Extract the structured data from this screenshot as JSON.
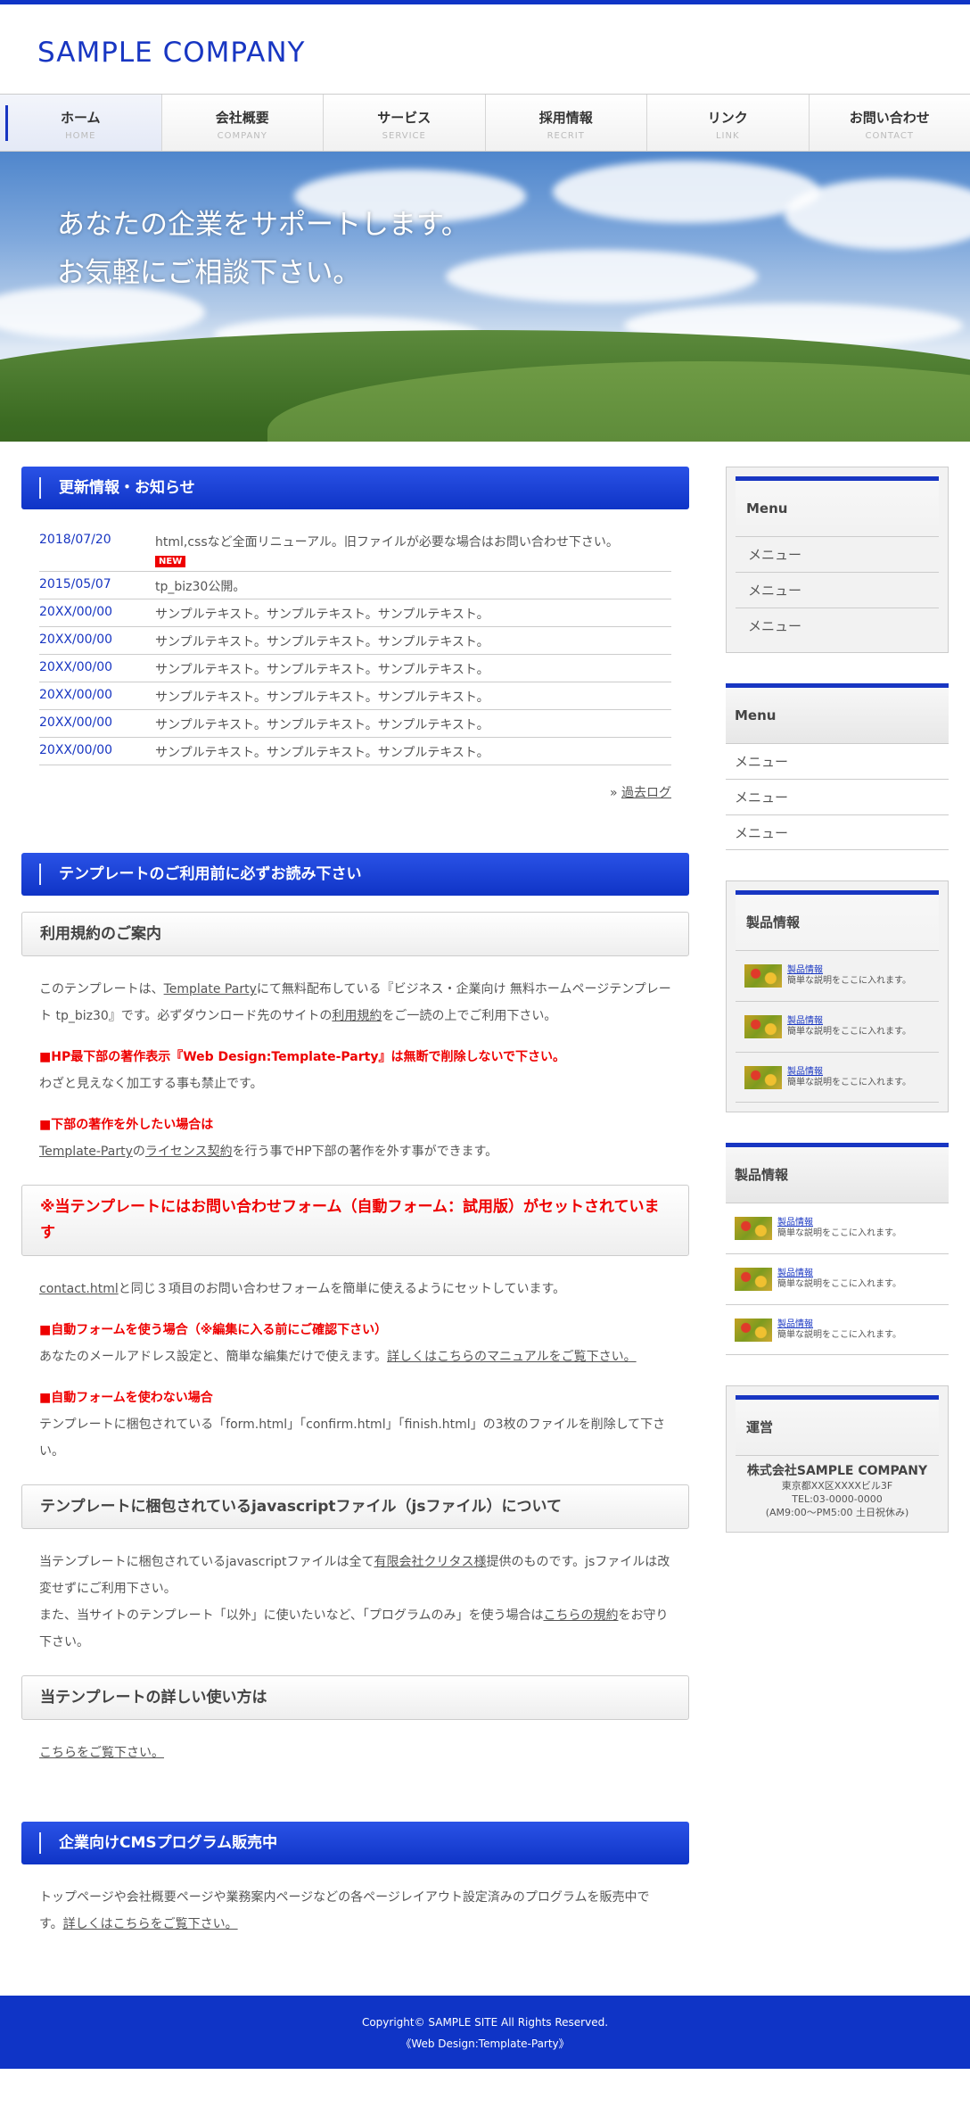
{
  "site": {
    "logo": "SAMPLE COMPANY"
  },
  "nav": [
    {
      "ja": "ホーム",
      "en": "HOME"
    },
    {
      "ja": "会社概要",
      "en": "COMPANY"
    },
    {
      "ja": "サービス",
      "en": "SERVICE"
    },
    {
      "ja": "採用情報",
      "en": "RECRIT"
    },
    {
      "ja": "リンク",
      "en": "LINK"
    },
    {
      "ja": "お問い合わせ",
      "en": "CONTACT"
    }
  ],
  "hero": {
    "line1": "あなたの企業をサポートします。",
    "line2": "お気軽にご相談下さい。"
  },
  "news": {
    "title": "更新情報・お知らせ",
    "items": [
      {
        "date": "2018/07/20",
        "text": "html,cssなど全面リニューアル。旧ファイルが必要な場合はお問い合わせ下さい。",
        "badge": "NEW"
      },
      {
        "date": "2015/05/07",
        "text": "tp_biz30公開。"
      },
      {
        "date": "20XX/00/00",
        "text": "サンプルテキスト。サンプルテキスト。サンプルテキスト。"
      },
      {
        "date": "20XX/00/00",
        "text": "サンプルテキスト。サンプルテキスト。サンプルテキスト。"
      },
      {
        "date": "20XX/00/00",
        "text": "サンプルテキスト。サンプルテキスト。サンプルテキスト。"
      },
      {
        "date": "20XX/00/00",
        "text": "サンプルテキスト。サンプルテキスト。サンプルテキスト。"
      },
      {
        "date": "20XX/00/00",
        "text": "サンプルテキスト。サンプルテキスト。サンプルテキスト。"
      },
      {
        "date": "20XX/00/00",
        "text": "サンプルテキスト。サンプルテキスト。サンプルテキスト。"
      }
    ],
    "more_prefix": "» ",
    "more": "過去ログ"
  },
  "template": {
    "title": "テンプレートのご利用前に必ずお読み下さい",
    "h_terms": "利用規約のご案内",
    "p1_a": "このテンプレートは、",
    "p1_link1": "Template Party",
    "p1_b": "にて無料配布している『ビジネス・企業向け 無料ホームページテンプレート tp_biz30』です。必ずダウンロード先のサイトの",
    "p1_link2": "利用規約",
    "p1_c": "をご一読の上でご利用下さい。",
    "red1": "■HP最下部の著作表示『Web Design:Template-Party』は無断で削除しないで下さい。",
    "p2": "わざと見えなく加工する事も禁止です。",
    "red2": "■下部の著作を外したい場合は",
    "p3_link1": "Template-Party",
    "p3_a": "の",
    "p3_link2": "ライセンス契約",
    "p3_b": "を行う事でHP下部の著作を外す事ができます。",
    "h_form": "※当テンプレートにはお問い合わせフォーム（自動フォーム：試用版）がセットされています",
    "p4_link": "contact.html",
    "p4_b": "と同じ３項目のお問い合わせフォームを簡単に使えるようにセットしています。",
    "red3": "■自動フォームを使う場合（※編集に入る前にご確認下さい）",
    "p5_a": "あなたのメールアドレス設定と、簡単な編集だけで使えます。",
    "p5_link": "詳しくはこちらのマニュアルをご覧下さい。",
    "red4": "■自動フォームを使わない場合",
    "p6": "テンプレートに梱包されている「form.html」「confirm.html」「finish.html」の3枚のファイルを削除して下さい。",
    "h_js": "テンプレートに梱包されているjavascriptファイル（jsファイル）について",
    "p7_a": "当テンプレートに梱包されているjavascriptファイルは全て",
    "p7_link1": "有限会社クリタス様",
    "p7_b": "提供のものです。jsファイルは改変せずにご利用下さい。",
    "p7_c": "また、当サイトのテンプレート「以外」に使いたいなど、「プログラムのみ」を使う場合は",
    "p7_link2": "こちらの規約",
    "p7_d": "をお守り下さい。",
    "h_howto": "当テンプレートの詳しい使い方は",
    "p8_link": "こちらをご覧下さい。"
  },
  "cms": {
    "title": "企業向けCMSプログラム販売中",
    "p_a": "トップページや会社概要ページや業務案内ページなどの各ページレイアウト設定済みのプログラムを販売中です。",
    "p_link": "詳しくはこちらをご覧下さい。"
  },
  "side": {
    "menu1": {
      "title": "Menu",
      "items": [
        "メニュー",
        "メニュー",
        "メニュー"
      ]
    },
    "menu2": {
      "title": "Menu",
      "items": [
        "メニュー",
        "メニュー",
        "メニュー"
      ]
    },
    "products1": {
      "title": "製品情報",
      "items": [
        {
          "name": "製品情報",
          "desc": "簡単な説明をここに入れます。"
        },
        {
          "name": "製品情報",
          "desc": "簡単な説明をここに入れます。"
        },
        {
          "name": "製品情報",
          "desc": "簡単な説明をここに入れます。"
        }
      ]
    },
    "products2": {
      "title": "製品情報",
      "items": [
        {
          "name": "製品情報",
          "desc": "簡単な説明をここに入れます。"
        },
        {
          "name": "製品情報",
          "desc": "簡単な説明をここに入れます。"
        },
        {
          "name": "製品情報",
          "desc": "簡単な説明をここに入れます。"
        }
      ]
    },
    "company": {
      "title": "運営",
      "name": "株式会社SAMPLE COMPANY",
      "address": "東京都XX区XXXXビル3F",
      "tel": "TEL:03-0000-0000",
      "hours": "(AM9:00〜PM5:00 土日祝休み)"
    }
  },
  "footer": {
    "copyright": "Copyright© SAMPLE SITE All Rights Reserved.",
    "credit": "《Web Design:Template-Party》"
  },
  "colors": {
    "accent": "#0f34c6",
    "red": "#ee0000"
  }
}
